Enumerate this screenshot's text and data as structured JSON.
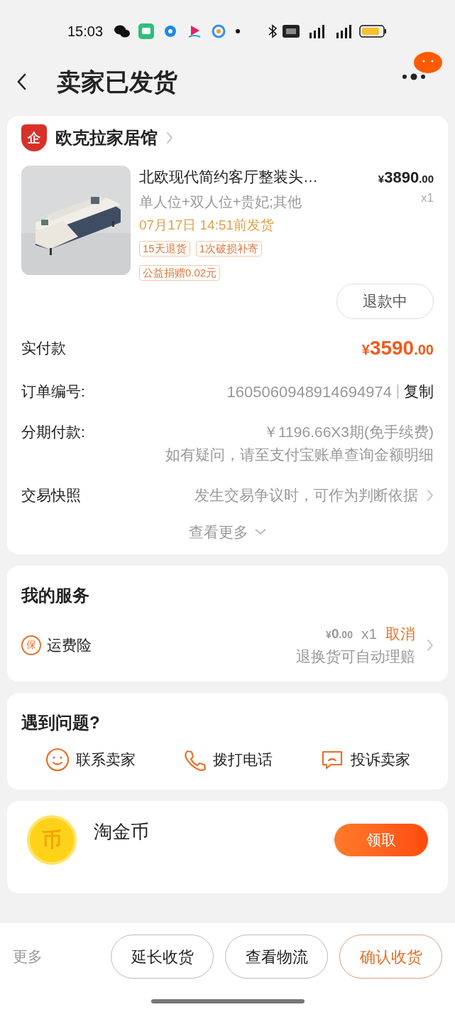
{
  "status_bar": {
    "time": "15:03"
  },
  "header": {
    "title": "卖家已发货"
  },
  "order": {
    "shop_name": "欧克拉家居馆",
    "shop_badge": "企",
    "product": {
      "title": "北欧现代简约客厅整装头…",
      "variant": "单人位+双人位+贵妃;其他",
      "ship_by": "07月17日 14:51前发货",
      "tags": [
        "15天退货",
        "1次破损补寄",
        "公益捐赠0.02元"
      ],
      "currency": "¥",
      "price": "3890",
      "price_decimal": ".00",
      "quantity": "x1"
    },
    "refund_button": "退款中",
    "rows": [
      {
        "kind": "amount",
        "label": "实付款",
        "currency": "¥",
        "value": "3590",
        "decimal": ".00"
      },
      {
        "kind": "copy",
        "label": "订单编号:",
        "value": "1605060948914694974",
        "action": "复制"
      },
      {
        "kind": "note",
        "label": "分期付款:",
        "value": "￥1196.66X3期(免手续费)",
        "note": "如有疑问，请至支付宝账单查询金额明细"
      },
      {
        "kind": "link",
        "label": "交易快照",
        "value": "发生交易争议时，可作为判断依据"
      }
    ],
    "more": "查看更多"
  },
  "services": {
    "title": "我的服务",
    "items": [
      {
        "badge": "保",
        "name": "运费险",
        "currency": "¥",
        "price": "0",
        "price_decimal": ".00",
        "quantity": "x1",
        "action": "取消",
        "note": "退换货可自动理赔"
      }
    ]
  },
  "problems": {
    "title": "遇到问题?",
    "actions": [
      {
        "kind": "chat",
        "label": "联系卖家"
      },
      {
        "kind": "phone",
        "label": "拨打电话"
      },
      {
        "kind": "complaint",
        "label": "投诉卖家"
      }
    ]
  },
  "coins": {
    "title": "淘金币",
    "coin_glyph": "币",
    "button": "领取"
  },
  "bottom_bar": {
    "more": "更多",
    "buttons": [
      {
        "label": "延长收货",
        "kind": "plain"
      },
      {
        "label": "查看物流",
        "kind": "plain"
      },
      {
        "label": "确认收货",
        "kind": "accent"
      }
    ]
  }
}
